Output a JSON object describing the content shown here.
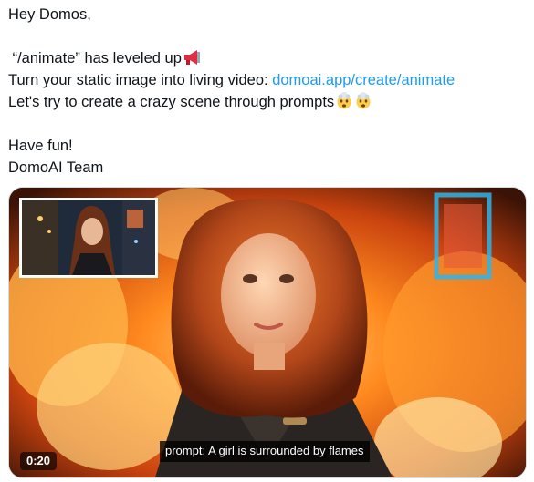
{
  "tweet": {
    "greeting": "Hey Domos,",
    "line_animate": "“/animate” has leveled up",
    "line_turn_prefix": "Turn your static image into living video: ",
    "link": "domoai.app/create/animate",
    "line_prompt": "Let's try to create a crazy scene through prompts",
    "closing": "Have fun!",
    "signature": "DomoAI Team",
    "icons": {
      "megaphone": "megaphone-emoji",
      "exploding_head": "exploding-head-emoji"
    }
  },
  "video": {
    "duration": "0:20",
    "caption": "prompt: A girl is surrounded by flames"
  },
  "colors": {
    "link": "#1d9bf0",
    "text": "#0f1419",
    "flame": "#ff9a2e"
  }
}
